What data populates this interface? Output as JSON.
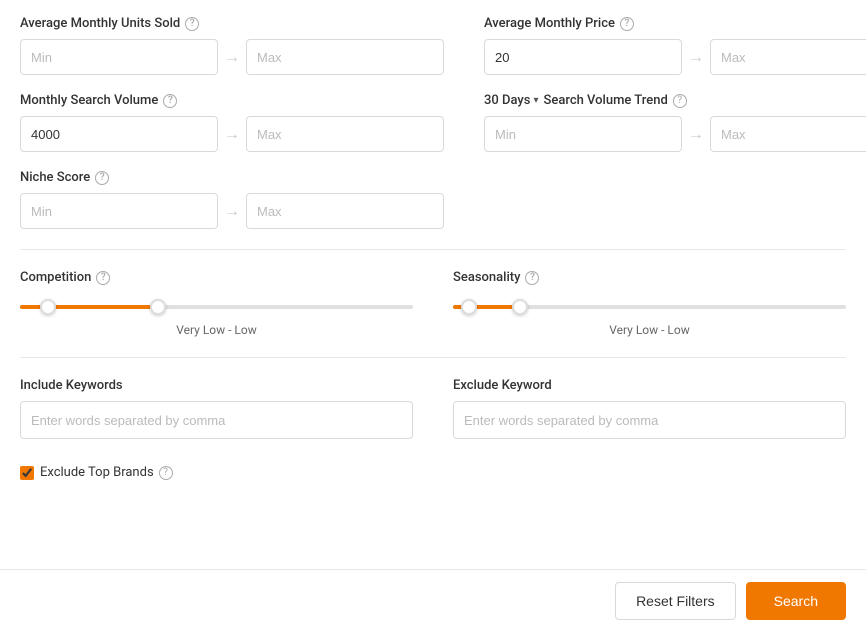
{
  "filters": {
    "avgMonthlyUnitsSold": {
      "label": "Average Monthly Units Sold",
      "minPlaceholder": "Min",
      "maxPlaceholder": "Max",
      "minValue": "",
      "maxValue": ""
    },
    "avgMonthlyPrice": {
      "label": "Average Monthly Price",
      "minPlaceholder": "20",
      "maxPlaceholder": "Max",
      "minValue": "20",
      "maxValue": ""
    },
    "monthlySearchVolume": {
      "label": "Monthly Search Volume",
      "minPlaceholder": "Min",
      "maxPlaceholder": "Max",
      "minValue": "4000",
      "maxValue": ""
    },
    "searchVolumeTrend": {
      "dropdownLabel": "30 Days",
      "label": "Search Volume Trend",
      "minPlaceholder": "Min",
      "maxPlaceholder": "Max",
      "minValue": "",
      "maxValue": ""
    },
    "nicheScore": {
      "label": "Niche Score",
      "minPlaceholder": "Min",
      "maxPlaceholder": "Max",
      "minValue": "",
      "maxValue": ""
    },
    "competition": {
      "label": "Competition",
      "rangeLabel": "Very Low  -  Low"
    },
    "seasonality": {
      "label": "Seasonality",
      "rangeLabel": "Very Low  -  Low"
    },
    "includeKeywords": {
      "label": "Include Keywords",
      "placeholder": "Enter words separated by comma",
      "value": ""
    },
    "excludeKeyword": {
      "label": "Exclude Keyword",
      "placeholder": "Enter words separated by comma",
      "value": ""
    },
    "excludeTopBrands": {
      "label": "Exclude Top Brands",
      "checked": true
    }
  },
  "buttons": {
    "resetLabel": "Reset Filters",
    "searchLabel": "Search"
  }
}
